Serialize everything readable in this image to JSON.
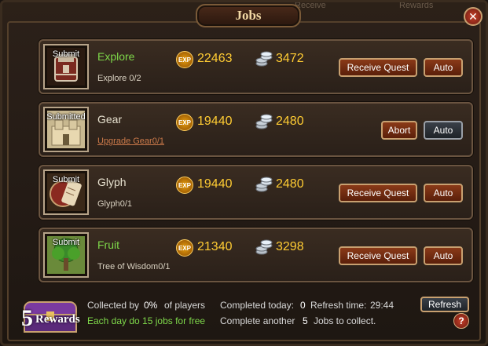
{
  "window": {
    "title": "Jobs",
    "ghost_texts": [
      "Receive",
      "Rewards"
    ]
  },
  "jobs": [
    {
      "status": "Submit",
      "name": "Explore",
      "name_color": "green",
      "progress": "Explore 0/2",
      "exp": "22463",
      "silver": "3472",
      "primary_button": "Receive Quest",
      "secondary_button": "Auto",
      "icon": "armored-chest-icon"
    },
    {
      "status": "Submitted",
      "name": "Gear",
      "name_color": "white",
      "progress": "Upgrade Gear0/1",
      "exp": "19440",
      "silver": "2480",
      "primary_button": "Abort",
      "secondary_button": "Auto",
      "icon": "castle-icon"
    },
    {
      "status": "Submit",
      "name": "Glyph",
      "name_color": "white",
      "progress": "Glyph0/1",
      "exp": "19440",
      "silver": "2480",
      "primary_button": "Receive Quest",
      "secondary_button": "Auto",
      "icon": "scroll-shield-icon"
    },
    {
      "status": "Submit",
      "name": "Fruit",
      "name_color": "green",
      "progress": "Tree of Wisdom0/1",
      "exp": "21340",
      "silver": "3298",
      "primary_button": "Receive Quest",
      "secondary_button": "Auto",
      "icon": "tree-icon"
    }
  ],
  "labels": {
    "exp_badge": "EXP"
  },
  "footer": {
    "rewards_count": "5",
    "rewards_label": "Rewards",
    "collected_prefix": "Collected by",
    "collected_pct": "0%",
    "collected_suffix": "of players",
    "daily_note": "Each day do 15 jobs for free",
    "completed_prefix": "Completed today:",
    "completed_val": "0",
    "refresh_prefix": "Refresh time:",
    "refresh_time": "29:44",
    "another_prefix": "Complete another",
    "another_val": "5",
    "another_suffix": "Jobs to collect.",
    "refresh_button": "Refresh",
    "help": "?"
  },
  "colors": {
    "green": "#7ed84a",
    "gold": "#ffcc33",
    "button_red": "#6a240e",
    "button_blue": "#2a3036"
  }
}
